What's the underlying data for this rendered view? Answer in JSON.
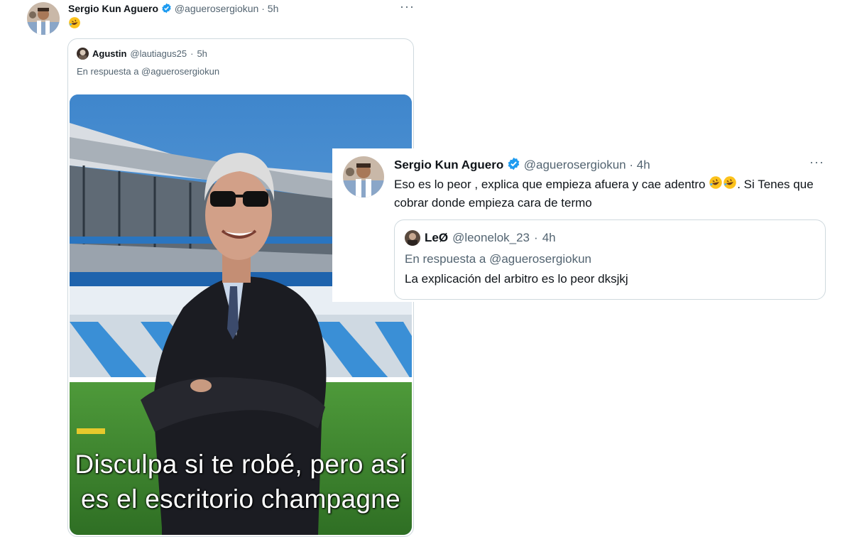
{
  "tweet1": {
    "name": "Sergio Kun Aguero",
    "handle": "@aguerosergiokun",
    "separator": "·",
    "time": "5h",
    "more": "···",
    "emoji": "rolling-on-floor-laughing",
    "quote": {
      "name": "Agustin",
      "handle": "@lautiagus25",
      "separator": "·",
      "time": "5h",
      "reply_to": "En respuesta a @aguerosergiokun",
      "caption_line1": "Disculpa si te robé, pero así",
      "caption_line2": "es el escritorio champagne"
    }
  },
  "tweet2": {
    "name": "Sergio Kun Aguero",
    "handle": "@aguerosergiokun",
    "separator": "·",
    "time": "4h",
    "more": "···",
    "text_before": "Eso es lo peor , explica que empieza afuera y cae adentro ",
    "text_after": ". Si Tenes que cobrar donde empieza cara de termo",
    "emoji": "rolling-on-floor-laughing",
    "quote": {
      "name": "LeØ",
      "handle": "@leonelok_23",
      "separator": "·",
      "time": "4h",
      "reply_to": "En respuesta a @aguerosergiokun",
      "text": "La explicación del arbitro es lo peor dksjkj"
    }
  },
  "colors": {
    "verified": "#1d9bf0",
    "muted": "#536471",
    "border": "#cfd9de",
    "sky": "#4a90d0",
    "grass": "#3d8a2e"
  }
}
